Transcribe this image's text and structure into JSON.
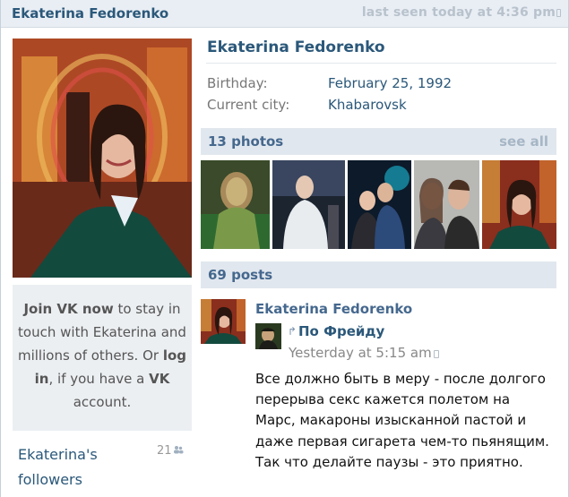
{
  "header": {
    "name": "Ekaterina Fedorenko",
    "last_seen": "last seen today at 4:36 pm",
    "icon": "mobile-phone-icon"
  },
  "profile": {
    "name": "Ekaterina Fedorenko",
    "fields": [
      {
        "label": "Birthday:",
        "value": "February 25, 1992"
      },
      {
        "label": "Current city:",
        "value": "Khabarovsk"
      }
    ]
  },
  "join_box": {
    "join_text": "Join VK now",
    "after_join": " to stay in touch with Ekaterina and millions of others. Or ",
    "login_text": "log in",
    "after_login": ", if you have a ",
    "vk_text": "VK",
    "after_vk": " account."
  },
  "followers": {
    "label": "Ekaterina's followers",
    "count": "21",
    "icon": "people-icon"
  },
  "photos": {
    "title": "13 photos",
    "see_all": "see all"
  },
  "posts": {
    "title": "69 posts",
    "items": [
      {
        "author": "Ekaterina Fedorenko",
        "repost_icon": "repost-arrow-icon",
        "group": "По Фрейду",
        "time": "Yesterday at 5:15 am",
        "time_icon": "mobile-phone-icon",
        "text": "Все должно быть в меру - после долгого перерыва секс кажется полетом на Марс, макароны изысканной пастой и даже первая сигарета чем-то пьянящим. Так что делайте паузы - это приятно."
      }
    ]
  },
  "colors": {
    "link": "#2b587a",
    "header_bg": "#e9eef4",
    "section_bg": "#e1e7ee",
    "join_bg": "#eceff2"
  }
}
